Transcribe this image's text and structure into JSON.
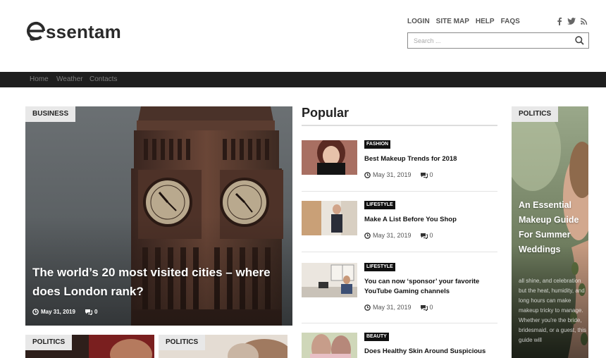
{
  "site": {
    "logo_text": "ssentam",
    "brand_color": "#2a2a2a"
  },
  "header": {
    "links": [
      "LOGIN",
      "SITE MAP",
      "HELP",
      "FAQS"
    ],
    "social_icons": [
      "facebook-icon",
      "twitter-icon",
      "rss-icon"
    ],
    "search_placeholder": "Search ..."
  },
  "nav": {
    "items": [
      "Home",
      "Weather",
      "Contacts"
    ]
  },
  "featured": {
    "category": "BUSINESS",
    "title": "The world’s 20 most visited cities – where does London rank?",
    "date": "May 31, 2019",
    "comments": "0"
  },
  "bottom_cards": [
    {
      "category": "POLITICS"
    },
    {
      "category": "POLITICS"
    }
  ],
  "popular": {
    "heading": "Popular",
    "items": [
      {
        "category": "FASHION",
        "title": "Best Makeup Trends for 2018",
        "date": "May 31, 2019",
        "comments": "0"
      },
      {
        "category": "LIFESTYLE",
        "title": "Make A List Before You Shop",
        "date": "May 31, 2019",
        "comments": "0"
      },
      {
        "category": "LIFESTYLE",
        "title": "You can now ‘sponsor’ your favorite YouTube Gaming channels",
        "date": "May 31, 2019",
        "comments": "0"
      },
      {
        "category": "BEAUTY",
        "title": "Does Healthy Skin Around Suspicious"
      }
    ]
  },
  "side_card": {
    "category": "POLITICS",
    "title": "An Essential Makeup Guide For Summer Weddings",
    "excerpt": "all shine, and celebration but the heat, humidity, and long hours can make makeup tricky to manage. Whether you're the bride, bridesmaid, or a guest, this guide will"
  }
}
